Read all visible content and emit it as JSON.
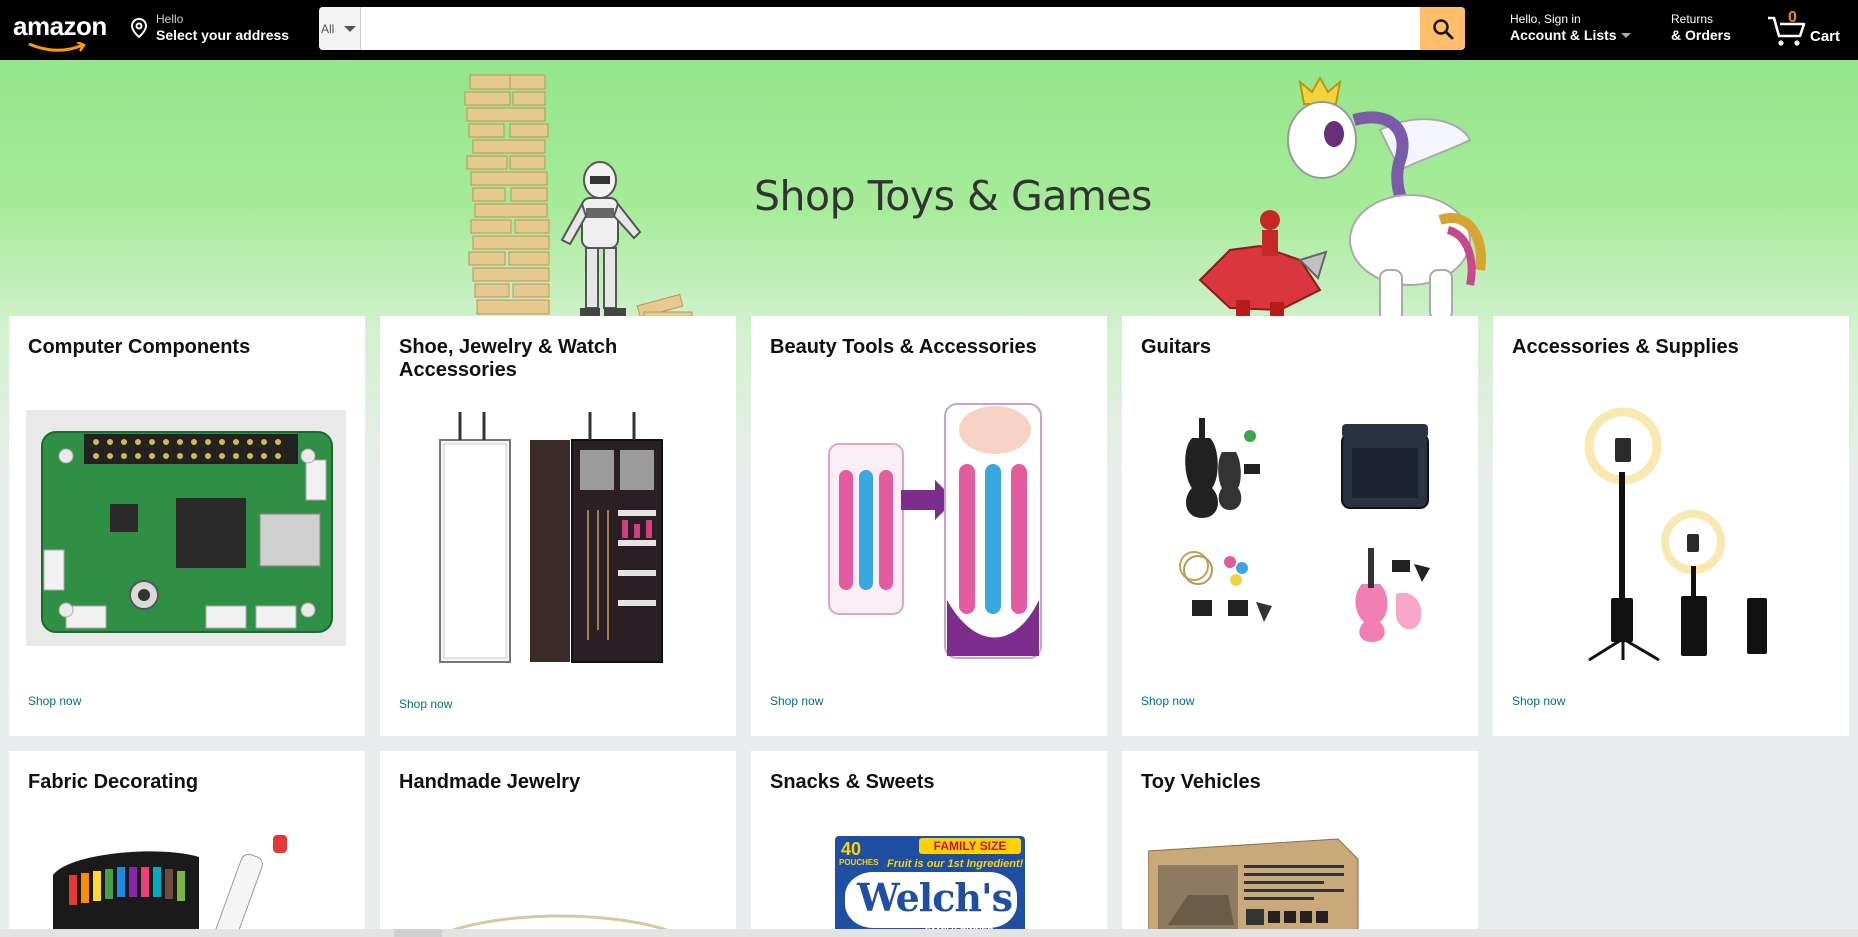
{
  "nav": {
    "logo": "amazon",
    "deliver": {
      "small": "Hello",
      "big": "Select your address"
    },
    "search": {
      "category": "All",
      "placeholder": ""
    },
    "account": {
      "small": "Hello, Sign in",
      "big": "Account & Lists"
    },
    "orders": {
      "small": "Returns",
      "big": "& Orders"
    },
    "cart": {
      "count": "0",
      "label": "Cart"
    }
  },
  "hero": {
    "title": "Shop Toys & Games"
  },
  "cards": [
    {
      "title": "Computer Components",
      "link": "Shop now"
    },
    {
      "title": "Shoe, Jewelry & Watch Accessories",
      "link": "Shop now"
    },
    {
      "title": "Beauty Tools & Accessories",
      "link": "Shop now"
    },
    {
      "title": "Guitars",
      "link": "Shop now"
    },
    {
      "title": "Accessories & Supplies",
      "link": "Shop now"
    },
    {
      "title": "Fabric Decorating"
    },
    {
      "title": "Handmade Jewelry"
    },
    {
      "title": "Snacks & Sweets",
      "image_text": {
        "count": "40",
        "unit": "POUCHES",
        "family": "FAMILY SIZE",
        "banner": "Fruit is our 1st Ingredient!",
        "brand": "Welch's",
        "sub": "FAMILY OWNED"
      }
    },
    {
      "title": "Toy Vehicles"
    }
  ],
  "colors": {
    "nav_bg": "#000000",
    "search_button": "#febd69",
    "link": "#007185",
    "cart_count": "#f08804",
    "hero_green": "#94e58c",
    "page_bg": "#eaeded"
  }
}
